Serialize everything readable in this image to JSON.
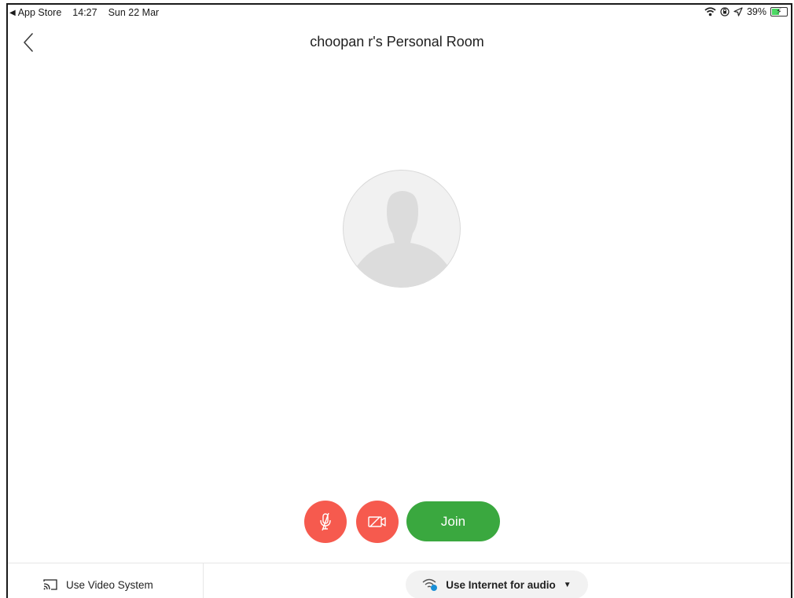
{
  "status_bar": {
    "back_app": "App Store",
    "time": "14:27",
    "date": "Sun 22 Mar",
    "battery": "39%"
  },
  "header": {
    "title": "choopan r's Personal Room"
  },
  "controls": {
    "join_label": "Join"
  },
  "bottom_bar": {
    "video_system_label": "Use Video System",
    "audio_label": "Use Internet for audio"
  },
  "colors": {
    "mute_button": "#f65a4e",
    "video_button": "#f65a4e",
    "join_button": "#3aa83f",
    "audio_indicator": "#1a8fd6",
    "battery_fill": "#4cd964"
  },
  "icons": {
    "back": "chevron-left-icon",
    "mute": "microphone-muted-icon",
    "video": "video-off-icon",
    "video_system": "cast-icon",
    "audio": "wifi-audio-icon",
    "dropdown": "caret-down-icon"
  }
}
